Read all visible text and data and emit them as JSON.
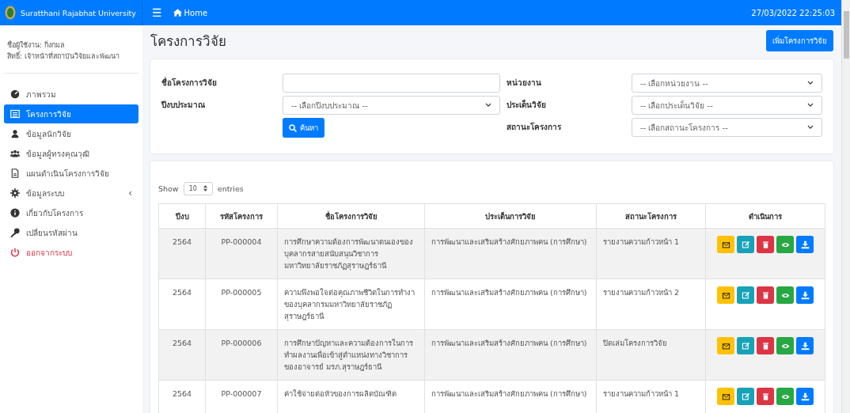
{
  "topbar": {
    "brand": "Suratthani Rajabhat University",
    "menu_icon": "☰",
    "home": "Home",
    "datetime": "27/03/2022 22:25:03"
  },
  "sidebar": {
    "user": "ชื่อผู้ใช้งาน: กิ่งกมล",
    "role": "สิทธิ์: เจ้าหน้าที่สถาบันวิจัยและพัฒนา",
    "items": [
      {
        "kind": "dashboard",
        "label": "ภาพรวม",
        "selected": false
      },
      {
        "kind": "list",
        "label": "โครงการวิจัย",
        "selected": true
      },
      {
        "kind": "user",
        "label": "ข้อมูลนักวิจัย",
        "selected": false
      },
      {
        "kind": "users",
        "label": "ข้อมูลผู้ทรงคุณวุฒิ",
        "selected": false
      },
      {
        "kind": "file",
        "label": "แผนดำเนินโครงการวิจัย",
        "selected": false
      },
      {
        "kind": "gear",
        "label": "ข้อมูลระบบ",
        "selected": false,
        "caret": "‹"
      },
      {
        "kind": "info",
        "label": "เกี่ยวกับโครงการ",
        "selected": false
      },
      {
        "kind": "key",
        "label": "เปลี่ยนรหัสผ่าน",
        "selected": false
      },
      {
        "kind": "logout",
        "label": "ออกจากระบบ",
        "selected": false
      }
    ]
  },
  "page_title": "โครงการวิจัย",
  "add_button": "เพิ่มโครงการวิจัย",
  "filters": [
    {
      "label": "ชื่อโครงการวิจัย",
      "kind": "text"
    },
    {
      "label": "หน่วยงาน",
      "kind": "select",
      "placeholder": "-- เลือกหน่วยงาน --"
    },
    {
      "label": "ปีงบประมาณ",
      "kind": "select",
      "placeholder": "-- เลือกปีงบประมาณ --"
    },
    {
      "label": "ประเด็นวิจัย",
      "kind": "select",
      "placeholder": "-- เลือกประเด็นวิจัย --"
    },
    {
      "kind": "search",
      "button": "ค้นหา"
    },
    {
      "label": "สถานะโครงการ",
      "kind": "select",
      "placeholder": "-- เลือกสถานะโครงการ --"
    }
  ],
  "length": {
    "show": "Show",
    "value": "10",
    "entries": "entries"
  },
  "table": {
    "columns": [
      "ปีงบ",
      "รหัสโครงการ",
      "ชื่อโครงการวิจัย",
      "ประเด็นการวิจัย",
      "สถานะโครงการ",
      "ดำเนินการ"
    ],
    "rows": [
      {
        "year": "2564",
        "code": "PP-000004",
        "name": "การศึกษาความต้องการพัฒนาตนเองของบุคลากรสายสนับสนุนวิชาการมหาวิทยาลัยราชภัฏสุราษฎร์ธานี",
        "issue": "การพัฒนาและเสริมสร้างศักยภาพคน (การศึกษา)",
        "status": "รายงานความก้าวหน้า 1",
        "actions": [
          {
            "kind": "mail"
          },
          {
            "kind": "edit"
          },
          {
            "kind": "delete"
          },
          {
            "kind": "view"
          },
          {
            "kind": "download"
          }
        ]
      },
      {
        "year": "2564",
        "code": "PP-000005",
        "name": "ความพึงพอใจต่อคุณภาพชีวิตในการทำงาของบุคลากรมมหาวิทยาลัยราชภัฏสุราษฎร์ธานี",
        "issue": "การพัฒนาและเสริมสร้างศักยภาพคน (การศึกษา)",
        "status": "รายงานความก้าวหน้า 2",
        "actions": [
          {
            "kind": "mail"
          },
          {
            "kind": "edit"
          },
          {
            "kind": "delete"
          },
          {
            "kind": "view"
          },
          {
            "kind": "download"
          }
        ]
      },
      {
        "year": "2564",
        "code": "PP-000006",
        "name": "การศึกษาปัญหาและความต้องการในการทำผลงานเพื่อเข้าสู่ตำแหน่งทางวิชาการของอาจารย์ มรภ.สุราษฎร์ธานี",
        "issue": "การพัฒนาและเสริมสร้างศักยภาพคน (การศึกษา)",
        "status": "ปิดเล่มโครงการวิจัย",
        "actions": [
          {
            "kind": "mail"
          },
          {
            "kind": "edit"
          },
          {
            "kind": "delete"
          },
          {
            "kind": "view"
          },
          {
            "kind": "download"
          }
        ]
      },
      {
        "year": "2564",
        "code": "PP-000007",
        "name": "ค่าใช้จ่ายต่อหัวของการผลิตบัณฑิต",
        "issue": "การพัฒนาและเสริมสร้างศักยภาพคน (การศึกษา)",
        "status": "รายงานความก้าวหน้า 1",
        "actions": [
          {
            "kind": "mail"
          },
          {
            "kind": "edit"
          },
          {
            "kind": "delete"
          },
          {
            "kind": "view"
          },
          {
            "kind": "download"
          }
        ]
      }
    ]
  }
}
